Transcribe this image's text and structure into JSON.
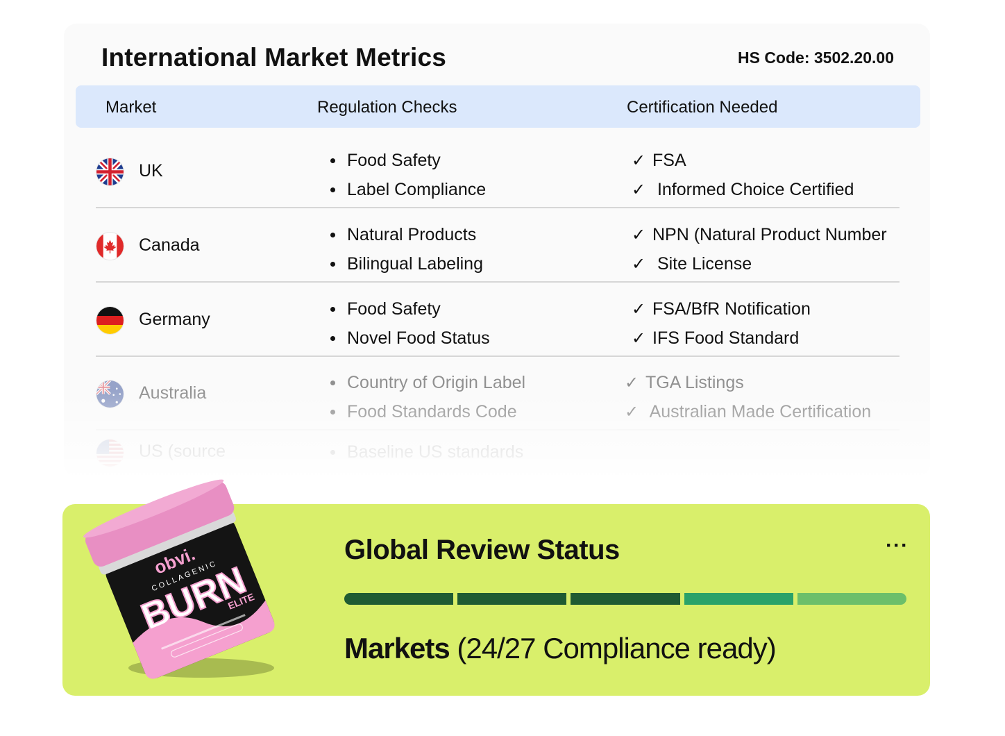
{
  "card": {
    "title": "International Market Metrics",
    "hs_code": "HS Code: 3502.20.00",
    "columns": [
      "Market",
      "Regulation Checks",
      "Certification Needed"
    ]
  },
  "rows": [
    {
      "country": "UK",
      "flag": "uk-flag-icon",
      "checks": [
        "Food Safety",
        "Label Compliance"
      ],
      "certs": [
        "FSA",
        " Informed Choice Certified"
      ]
    },
    {
      "country": "Canada",
      "flag": "canada-flag-icon",
      "checks": [
        "Natural Products",
        "Bilingual Labeling"
      ],
      "certs": [
        "NPN (Natural Product Number",
        " Site License"
      ]
    },
    {
      "country": "Germany",
      "flag": "germany-flag-icon",
      "checks": [
        "Food Safety",
        "Novel Food Status"
      ],
      "certs": [
        "FSA/BfR Notification",
        "IFS Food Standard"
      ]
    },
    {
      "country": "Australia",
      "flag": "australia-flag-icon",
      "checks": [
        "Country of Origin Label",
        "Food Standards Code"
      ],
      "certs": [
        "TGA Listings",
        " Australian Made Certification"
      ]
    },
    {
      "country": "US (source",
      "flag": "us-flag-icon",
      "checks": [
        "Baseline US standards"
      ],
      "certs": []
    }
  ],
  "tick": "✓",
  "status": {
    "title": "Global Review Status",
    "more": "···",
    "markets_bold": "Markets",
    "markets_rest": " (24/27 Compliance ready)",
    "progress_segments": [
      "#1f5b32",
      "#1f5b32",
      "#1f5b32",
      "#2aa269",
      "#6cbf6a"
    ]
  },
  "product": {
    "brand": "obvi.",
    "line": "COLLAGENIC",
    "name": "BURN",
    "variant": "ELITE",
    "colors": {
      "lid": "#e88fc3",
      "jar": "#141414",
      "accent": "#f5a0cf"
    }
  }
}
